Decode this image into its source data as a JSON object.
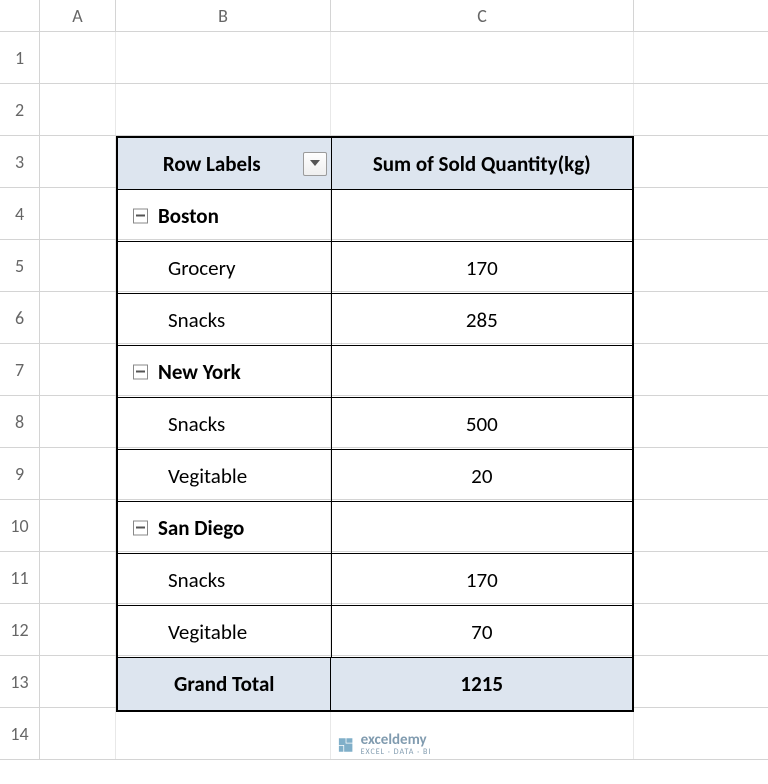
{
  "columns": [
    "A",
    "B",
    "C"
  ],
  "rows": [
    "1",
    "2",
    "3",
    "4",
    "5",
    "6",
    "7",
    "8",
    "9",
    "10",
    "11",
    "12",
    "13",
    "14"
  ],
  "pivot": {
    "header_b": "Row Labels",
    "header_c": "Sum of Sold Quantity(kg)",
    "groups": [
      {
        "name": "Boston",
        "items": [
          {
            "label": "Grocery",
            "value": "170"
          },
          {
            "label": "Snacks",
            "value": "285"
          }
        ]
      },
      {
        "name": "New York",
        "items": [
          {
            "label": "Snacks",
            "value": "500"
          },
          {
            "label": "Vegitable",
            "value": "20"
          }
        ]
      },
      {
        "name": "San Diego",
        "items": [
          {
            "label": "Snacks",
            "value": "170"
          },
          {
            "label": "Vegitable",
            "value": "70"
          }
        ]
      }
    ],
    "total_label": "Grand Total",
    "total_value": "1215"
  },
  "watermark": {
    "brand": "exceldemy",
    "tagline": "EXCEL · DATA · BI"
  },
  "chart_data": {
    "type": "table",
    "title": "Sum of Sold Quantity(kg)",
    "rows": [
      {
        "city": "Boston",
        "category": "Grocery",
        "value": 170
      },
      {
        "city": "Boston",
        "category": "Snacks",
        "value": 285
      },
      {
        "city": "New York",
        "category": "Snacks",
        "value": 500
      },
      {
        "city": "New York",
        "category": "Vegitable",
        "value": 20
      },
      {
        "city": "San Diego",
        "category": "Snacks",
        "value": 170
      },
      {
        "city": "San Diego",
        "category": "Vegitable",
        "value": 70
      }
    ],
    "grand_total": 1215
  }
}
